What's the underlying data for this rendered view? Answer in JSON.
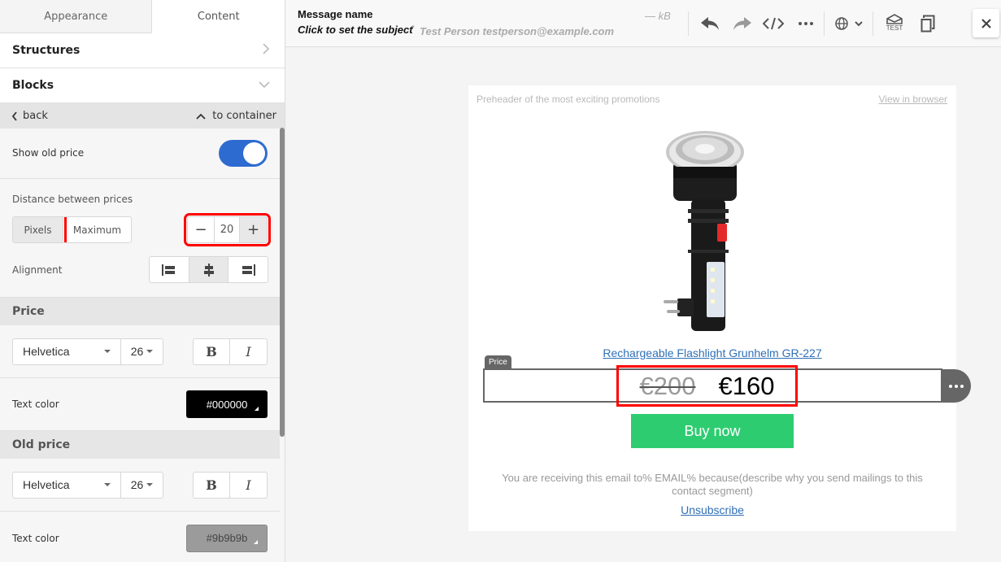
{
  "left_panel": {
    "tabs": [
      {
        "label": "Appearance",
        "active": false
      },
      {
        "label": "Content",
        "active": true
      }
    ],
    "accordions": [
      {
        "label": "Structures",
        "icon": "chevron-right-icon"
      },
      {
        "label": "Blocks",
        "icon": "chevron-down-icon"
      }
    ],
    "nav": {
      "back_label": "back",
      "to_container_label": "to container"
    },
    "show_old_price": {
      "label": "Show old price",
      "enabled": true
    },
    "distance": {
      "label": "Distance between prices",
      "modes": [
        "Pixels",
        "Maximum"
      ],
      "selected_mode": "Pixels",
      "value": "20",
      "minus": "−",
      "plus": "+"
    },
    "alignment": {
      "label": "Alignment",
      "options": [
        "left",
        "center",
        "right"
      ],
      "selected": "center"
    },
    "price_section": {
      "title": "Price",
      "font": "Helvetica",
      "size": "26",
      "bold_label": "B",
      "italic_label": "I",
      "text_color_label": "Text color",
      "text_color": "#000000"
    },
    "old_price_section": {
      "title": "Old price",
      "font": "Helvetica",
      "size": "26",
      "bold_label": "B",
      "italic_label": "I",
      "text_color_label": "Text color",
      "text_color": "#9b9b9b"
    }
  },
  "topbar": {
    "message_name": "Message name",
    "subject": "Click to set the subject",
    "separator": "•",
    "sender": "Test Person testperson@example.com",
    "size": "— kB",
    "test_label": "TEST",
    "icons": [
      "undo-icon",
      "redo-icon",
      "code-icon",
      "more-icon",
      "globe-icon",
      "chevron-down-icon",
      "test-send-icon",
      "copy-icon",
      "close-icon"
    ]
  },
  "email": {
    "preheader": "Preheader of the most exciting promotions",
    "view_in_browser": "View in browser",
    "product_title": "Rechargeable Flashlight Grunhelm GR-227",
    "price_tag_label": "Price",
    "old_price": "€200",
    "new_price": "€160",
    "buy_button": "Buy now",
    "footer_text": "You are receiving this email to% EMAIL% because(describe why you send mailings to this contact segment)",
    "unsubscribe": "Unsubscribe"
  },
  "colors": {
    "accent_blue": "#2d6bd0",
    "buy_green": "#2ecc71",
    "highlight_red": "#ff0000",
    "link_blue": "#2f6fb7"
  }
}
